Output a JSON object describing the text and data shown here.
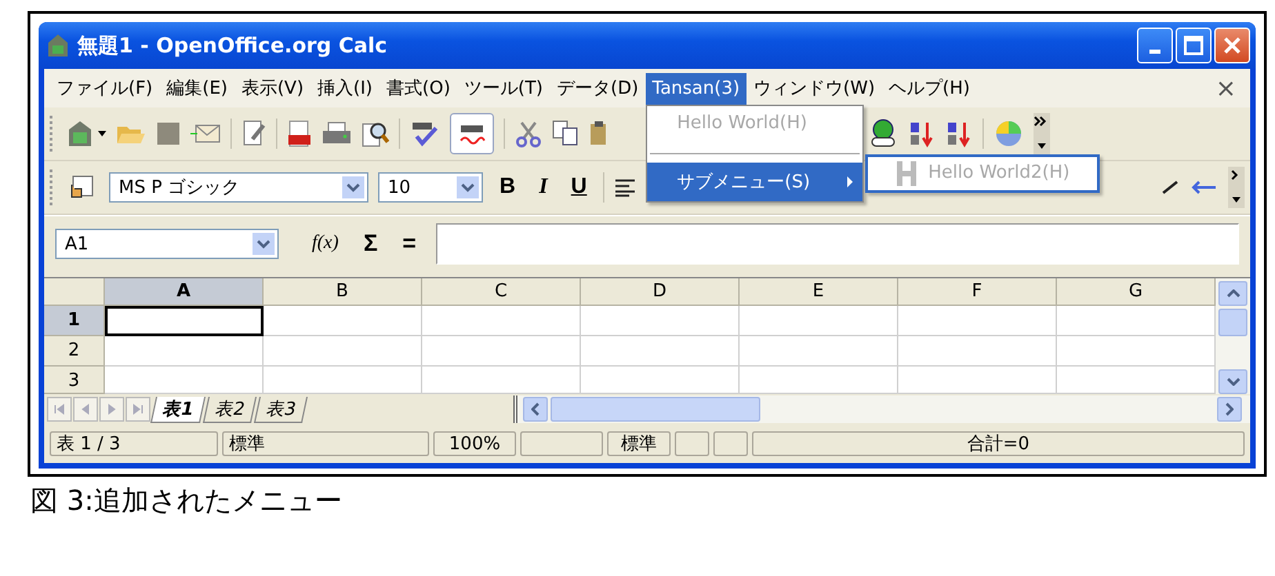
{
  "window": {
    "title": "無題1 - OpenOffice.org Calc"
  },
  "menu_bar": {
    "items": [
      {
        "label": "ファイル(F)",
        "selected": false
      },
      {
        "label": "編集(E)",
        "selected": false
      },
      {
        "label": "表示(V)",
        "selected": false
      },
      {
        "label": "挿入(I)",
        "selected": false
      },
      {
        "label": "書式(O)",
        "selected": false
      },
      {
        "label": "ツール(T)",
        "selected": false
      },
      {
        "label": "データ(D)",
        "selected": false
      },
      {
        "label": "Tansan(3)",
        "selected": true
      },
      {
        "label": "ウィンドウ(W)",
        "selected": false
      },
      {
        "label": "ヘルプ(H)",
        "selected": false
      }
    ],
    "close": "×"
  },
  "menu": {
    "items": [
      {
        "kind": "item",
        "label": "Hello World(H)",
        "disabled": true,
        "selected": false
      },
      {
        "kind": "separator"
      },
      {
        "kind": "submenu",
        "label": "サブメニュー(S)",
        "disabled": false,
        "selected": true
      }
    ]
  },
  "submenu": {
    "items": [
      {
        "label": "Hello World2(H)",
        "disabled": true
      }
    ]
  },
  "formatting": {
    "font": "MS P ゴシック",
    "size": "10",
    "buttons": [
      "B",
      "I",
      "U"
    ]
  },
  "formula_bar": {
    "name_box": "A1",
    "function_wizard": "f(x)",
    "sum": "Σ",
    "equals": "="
  },
  "sheet": {
    "columns": [
      {
        "label": "A",
        "selected": true
      },
      {
        "label": "B",
        "selected": false
      },
      {
        "label": "C",
        "selected": false
      },
      {
        "label": "D",
        "selected": false
      },
      {
        "label": "E",
        "selected": false
      },
      {
        "label": "F",
        "selected": false
      },
      {
        "label": "G",
        "selected": false
      }
    ],
    "rows": [
      {
        "label": "1",
        "selected": true
      },
      {
        "label": "2",
        "selected": false
      },
      {
        "label": "3",
        "selected": false
      }
    ]
  },
  "sheet_tabs": [
    {
      "label": "表1",
      "selected": true
    },
    {
      "label": "表2",
      "selected": false
    },
    {
      "label": "表3",
      "selected": false
    }
  ],
  "status_bar": {
    "sheet": "表 1 / 3",
    "style": "標準",
    "zoom": "100%",
    "mode": "標準",
    "sum": "合計=0"
  },
  "caption": "図 3:追加されたメニュー"
}
